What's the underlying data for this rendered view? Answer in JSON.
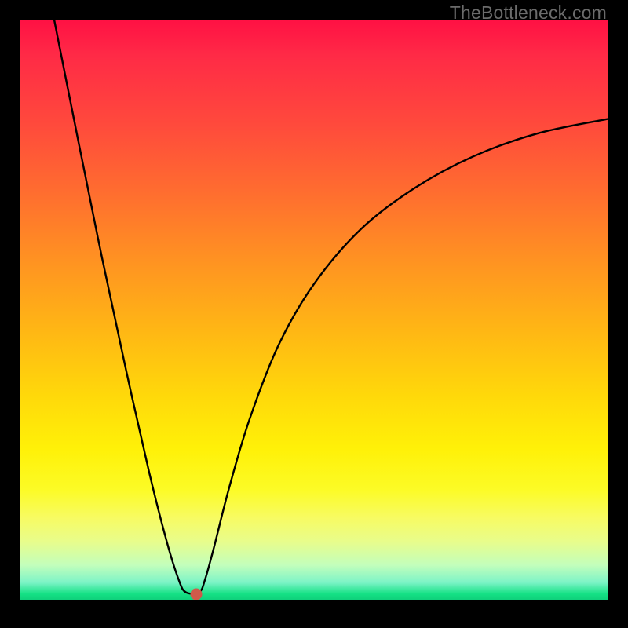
{
  "watermark": "TheBottleneck.com",
  "dot": {
    "x_pct": 30.0,
    "y_pct": 99.0,
    "color": "#cf5a4a"
  },
  "curve": {
    "points": [
      {
        "x_pct": 5.5,
        "y_pct": -2.0
      },
      {
        "x_pct": 10.0,
        "y_pct": 21.0
      },
      {
        "x_pct": 14.0,
        "y_pct": 41.0
      },
      {
        "x_pct": 18.0,
        "y_pct": 60.0
      },
      {
        "x_pct": 22.0,
        "y_pct": 78.0
      },
      {
        "x_pct": 25.0,
        "y_pct": 90.0
      },
      {
        "x_pct": 27.0,
        "y_pct": 96.5
      },
      {
        "x_pct": 28.2,
        "y_pct": 98.7
      },
      {
        "x_pct": 30.5,
        "y_pct": 98.7
      },
      {
        "x_pct": 31.5,
        "y_pct": 96.5
      },
      {
        "x_pct": 33.0,
        "y_pct": 91.0
      },
      {
        "x_pct": 35.5,
        "y_pct": 81.0
      },
      {
        "x_pct": 39.0,
        "y_pct": 69.0
      },
      {
        "x_pct": 44.0,
        "y_pct": 56.0
      },
      {
        "x_pct": 50.0,
        "y_pct": 45.5
      },
      {
        "x_pct": 58.0,
        "y_pct": 36.0
      },
      {
        "x_pct": 67.0,
        "y_pct": 29.0
      },
      {
        "x_pct": 77.0,
        "y_pct": 23.5
      },
      {
        "x_pct": 88.0,
        "y_pct": 19.5
      },
      {
        "x_pct": 100.0,
        "y_pct": 17.0
      }
    ],
    "stroke": "#000000",
    "stroke_width": 2.4
  },
  "chart_data": {
    "type": "line",
    "title": "",
    "xlabel": "",
    "ylabel": "",
    "x": [
      5.5,
      10,
      14,
      18,
      22,
      25,
      27,
      28.2,
      30.5,
      31.5,
      33,
      35.5,
      39,
      44,
      50,
      58,
      67,
      77,
      88,
      100
    ],
    "values": [
      102,
      79,
      59,
      40,
      22,
      10,
      3.5,
      1.3,
      1.3,
      3.5,
      9,
      19,
      31,
      44,
      54.5,
      64,
      71,
      76.5,
      80.5,
      83
    ],
    "ylim": [
      0,
      100
    ],
    "xlim": [
      0,
      100
    ],
    "marker": {
      "x": 30,
      "y": 1
    },
    "note": "x and y are percentages of the plot area; values = 100 - y_pct (so 0 is bottom / green, 100 is top / red). Curve depicts a bottleneck-style V shape with minimum near x≈29."
  }
}
